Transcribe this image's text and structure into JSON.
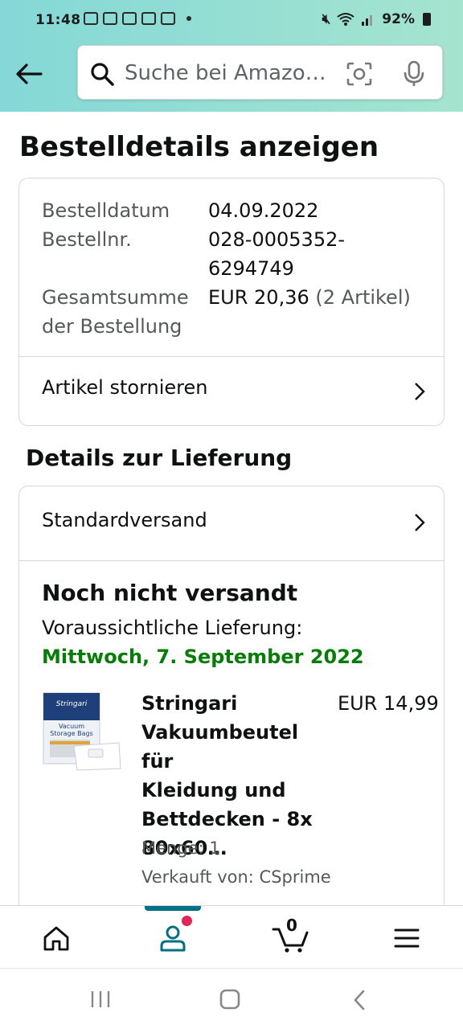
{
  "status_bar": {
    "time": "11:48",
    "battery": "92%"
  },
  "search": {
    "placeholder": "Suche bei Amazo…"
  },
  "page": {
    "title": "Bestelldetails anzeigen"
  },
  "order_summary": {
    "date_label": "Bestelldatum",
    "date_value": "04.09.2022",
    "number_label": "Bestellnr.",
    "number_value_line1": "028-0005352-",
    "number_value_line2": "6294749",
    "total_label_line1": "Gesamtsumme",
    "total_label_line2": "der Bestellung",
    "total_value": "EUR 20,36",
    "total_items": "(2 Artikel)",
    "cancel_label": "Artikel stornieren"
  },
  "delivery": {
    "section_title": "Details zur Lieferung",
    "shipping_method": "Standardversand",
    "status": "Noch nicht versandt",
    "eta_label": "Voraussichtliche Lieferung:",
    "eta_date": "Mittwoch, 7. September 2022"
  },
  "product": {
    "title_lines": [
      "Stringari",
      "Vakuumbeutel für",
      "Kleidung und",
      "Bettdecken - 8x",
      "80x60…"
    ],
    "price": "EUR 14,99",
    "quantity": "Menge: 1",
    "seller": "Verkauft von: CSprime",
    "image_brand": "Stringari",
    "image_text": "Vacuum Storage Bags"
  },
  "bottom_nav": {
    "cart_count": "0"
  },
  "colors": {
    "header_gradient_start": "#84d8d7",
    "header_gradient_end": "#a5e4cf",
    "eta_green": "#067d06",
    "accent_teal": "#007185",
    "badge_pink": "#e1245c"
  }
}
